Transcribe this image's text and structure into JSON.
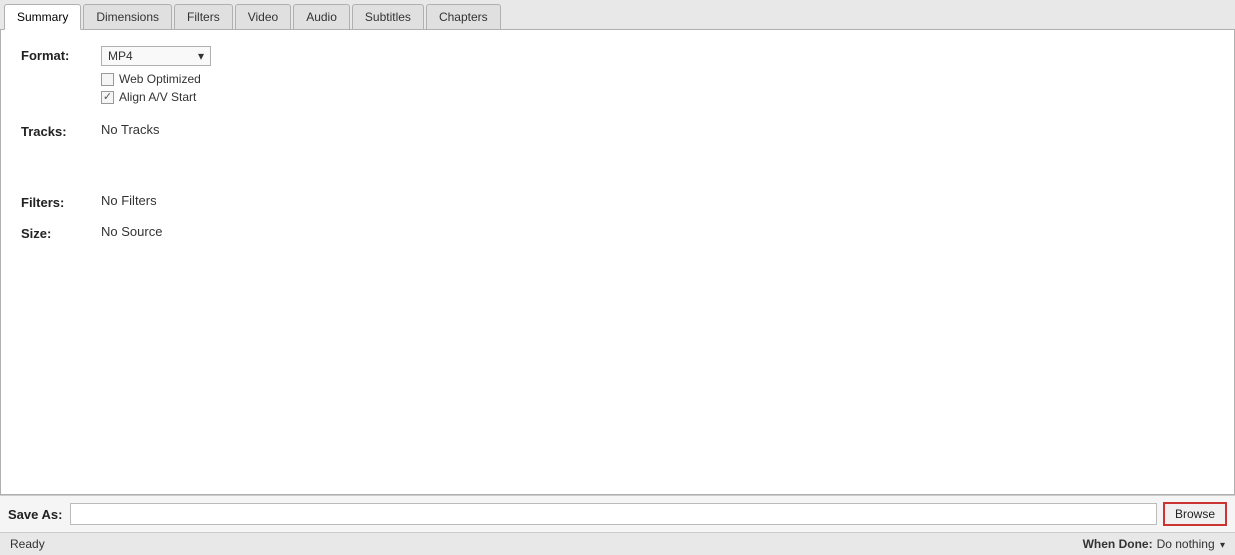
{
  "tabs": [
    {
      "label": "Summary",
      "active": true
    },
    {
      "label": "Dimensions",
      "active": false
    },
    {
      "label": "Filters",
      "active": false
    },
    {
      "label": "Video",
      "active": false
    },
    {
      "label": "Audio",
      "active": false
    },
    {
      "label": "Subtitles",
      "active": false
    },
    {
      "label": "Chapters",
      "active": false
    }
  ],
  "summary": {
    "format_label": "Format:",
    "format_value": "MP4",
    "web_optimized_label": "Web Optimized",
    "align_av_start_label": "Align A/V Start",
    "web_optimized_checked": false,
    "align_av_checked": true,
    "tracks_label": "Tracks:",
    "tracks_value": "No Tracks",
    "filters_label": "Filters:",
    "filters_value": "No Filters",
    "size_label": "Size:",
    "size_value": "No Source"
  },
  "save_bar": {
    "label": "Save As:",
    "input_value": "",
    "browse_label": "Browse"
  },
  "status_bar": {
    "status": "Ready",
    "when_done_label": "When Done:",
    "when_done_value": "Do nothing"
  }
}
